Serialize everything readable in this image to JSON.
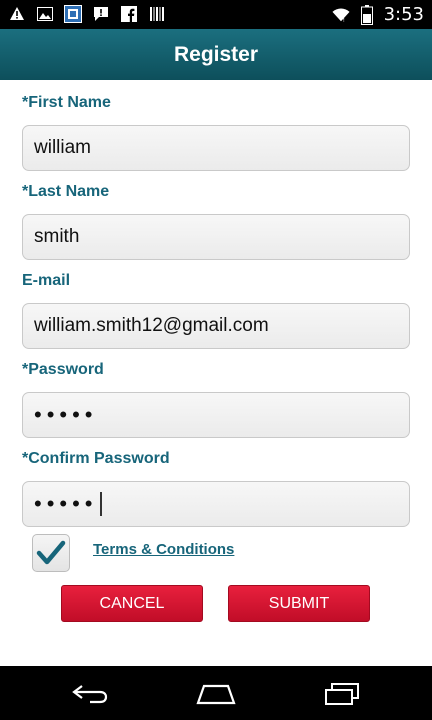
{
  "status_bar": {
    "time": "3:53",
    "icons": [
      "warning-icon",
      "image-icon",
      "app-icon",
      "message-alert-icon",
      "facebook-icon",
      "barcode-icon",
      "wifi-icon",
      "battery-icon"
    ]
  },
  "header": {
    "title": "Register"
  },
  "form": {
    "first_name": {
      "label": "*First Name",
      "value": "william"
    },
    "last_name": {
      "label": "*Last Name",
      "value": "smith"
    },
    "email": {
      "label": "E-mail",
      "value": "william.smith12@gmail.com"
    },
    "password": {
      "label": "*Password",
      "value": "•••••"
    },
    "confirm_password": {
      "label": "*Confirm Password",
      "value": "•••••"
    }
  },
  "terms": {
    "label": "Terms & Conditions",
    "checked": true
  },
  "buttons": {
    "cancel": "CANCEL",
    "submit": "SUBMIT"
  },
  "colors": {
    "header": "#0d4f5b",
    "label": "#17657a",
    "button": "#d41530"
  },
  "nav_bar": {
    "icons": [
      "back-icon",
      "home-icon",
      "recent-apps-icon"
    ]
  }
}
